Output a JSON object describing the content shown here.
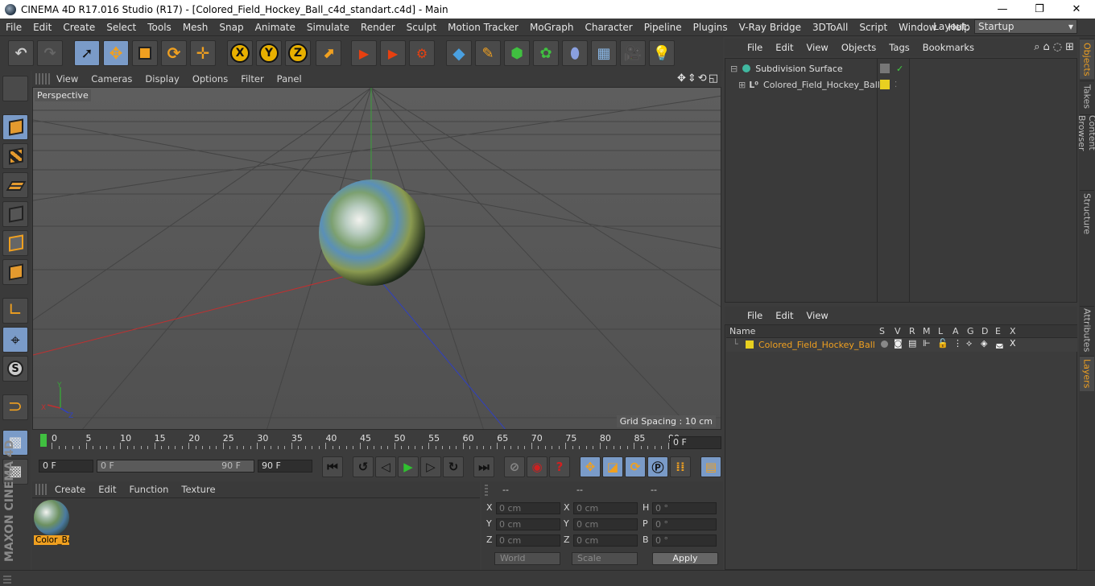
{
  "titlebar": {
    "title": "CINEMA 4D R17.016 Studio (R17) - [Colored_Field_Hockey_Ball_c4d_standart.c4d] - Main",
    "minimize": "—",
    "maximize": "❐",
    "close": "✕"
  },
  "menubar": {
    "items": [
      "File",
      "Edit",
      "Create",
      "Select",
      "Tools",
      "Mesh",
      "Snap",
      "Animate",
      "Simulate",
      "Render",
      "Sculpt",
      "Motion Tracker",
      "MoGraph",
      "Character",
      "Pipeline",
      "Plugins",
      "V-Ray Bridge",
      "3DToAll",
      "Script",
      "Window",
      "Help"
    ],
    "layout_label": "Layout:",
    "layout_value": "Startup"
  },
  "toolbar": {
    "axis_x": "X",
    "axis_y": "Y",
    "axis_z": "Z"
  },
  "viewport": {
    "menu": [
      "View",
      "Cameras",
      "Display",
      "Options",
      "Filter",
      "Panel"
    ],
    "camera_label": "Perspective",
    "grid_spacing": "Grid Spacing : 10 cm",
    "axis_x": "X",
    "axis_y": "Y",
    "axis_z": "Z"
  },
  "timeline": {
    "labels": [
      "0",
      "5",
      "10",
      "15",
      "20",
      "25",
      "30",
      "35",
      "40",
      "45",
      "50",
      "55",
      "60",
      "65",
      "70",
      "75",
      "80",
      "85",
      "90"
    ],
    "current_frame": "0 F"
  },
  "transport": {
    "start_frame": "0 F",
    "range_start": "0 F",
    "range_end": "90 F",
    "end_frame": "90 F"
  },
  "material_manager": {
    "menu": [
      "Create",
      "Edit",
      "Function",
      "Texture"
    ],
    "material_name": "Color_Ba"
  },
  "coordinates": {
    "headers": [
      "--",
      "--",
      "--"
    ],
    "rows": [
      {
        "l1": "X",
        "v1": "0 cm",
        "l2": "X",
        "v2": "0 cm",
        "l3": "H",
        "v3": "0 °"
      },
      {
        "l1": "Y",
        "v1": "0 cm",
        "l2": "Y",
        "v2": "0 cm",
        "l3": "P",
        "v3": "0 °"
      },
      {
        "l1": "Z",
        "v1": "0 cm",
        "l2": "Z",
        "v2": "0 cm",
        "l3": "B",
        "v3": "0 °"
      }
    ],
    "space": "World",
    "mode": "Scale",
    "apply": "Apply"
  },
  "object_manager": {
    "menu": [
      "File",
      "Edit",
      "View",
      "Objects",
      "Tags",
      "Bookmarks"
    ],
    "objects": [
      {
        "name": "Subdivision Surface"
      },
      {
        "name": "Colored_Field_Hockey_Ball"
      }
    ]
  },
  "layer_manager": {
    "menu": [
      "File",
      "Edit",
      "View"
    ],
    "columns": [
      "Name",
      "S",
      "V",
      "R",
      "M",
      "L",
      "A",
      "G",
      "D",
      "E",
      "X"
    ],
    "layer_name": "Colored_Field_Hockey_Ball",
    "layer_color": "#e8d020"
  },
  "right_tabs": {
    "top": [
      "Objects",
      "Takes",
      "Content Browser",
      "Structure"
    ],
    "bottom": [
      "Attributes",
      "Layers"
    ]
  },
  "branding": {
    "maxon_text": "MAXON CINEMA 4D"
  },
  "colors": {
    "accent": "#f0a020",
    "active_tool": "#7a9bc8",
    "background": "#3c3c3c"
  }
}
